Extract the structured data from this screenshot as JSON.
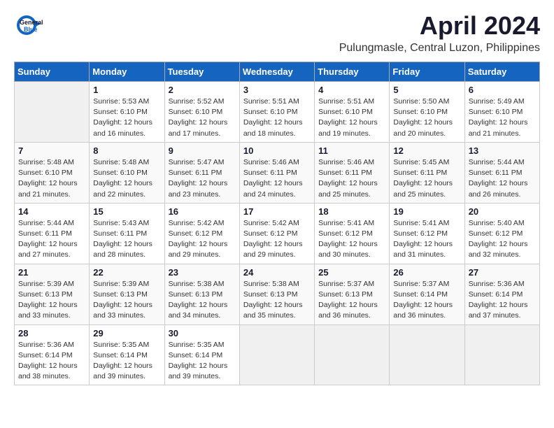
{
  "logo": {
    "line1": "General",
    "line2": "Blue"
  },
  "title": "April 2024",
  "subtitle": "Pulungmasle, Central Luzon, Philippines",
  "days_of_week": [
    "Sunday",
    "Monday",
    "Tuesday",
    "Wednesday",
    "Thursday",
    "Friday",
    "Saturday"
  ],
  "weeks": [
    [
      {
        "day": "",
        "info": ""
      },
      {
        "day": "1",
        "info": "Sunrise: 5:53 AM\nSunset: 6:10 PM\nDaylight: 12 hours\nand 16 minutes."
      },
      {
        "day": "2",
        "info": "Sunrise: 5:52 AM\nSunset: 6:10 PM\nDaylight: 12 hours\nand 17 minutes."
      },
      {
        "day": "3",
        "info": "Sunrise: 5:51 AM\nSunset: 6:10 PM\nDaylight: 12 hours\nand 18 minutes."
      },
      {
        "day": "4",
        "info": "Sunrise: 5:51 AM\nSunset: 6:10 PM\nDaylight: 12 hours\nand 19 minutes."
      },
      {
        "day": "5",
        "info": "Sunrise: 5:50 AM\nSunset: 6:10 PM\nDaylight: 12 hours\nand 20 minutes."
      },
      {
        "day": "6",
        "info": "Sunrise: 5:49 AM\nSunset: 6:10 PM\nDaylight: 12 hours\nand 21 minutes."
      }
    ],
    [
      {
        "day": "7",
        "info": "Sunrise: 5:48 AM\nSunset: 6:10 PM\nDaylight: 12 hours\nand 21 minutes."
      },
      {
        "day": "8",
        "info": "Sunrise: 5:48 AM\nSunset: 6:10 PM\nDaylight: 12 hours\nand 22 minutes."
      },
      {
        "day": "9",
        "info": "Sunrise: 5:47 AM\nSunset: 6:11 PM\nDaylight: 12 hours\nand 23 minutes."
      },
      {
        "day": "10",
        "info": "Sunrise: 5:46 AM\nSunset: 6:11 PM\nDaylight: 12 hours\nand 24 minutes."
      },
      {
        "day": "11",
        "info": "Sunrise: 5:46 AM\nSunset: 6:11 PM\nDaylight: 12 hours\nand 25 minutes."
      },
      {
        "day": "12",
        "info": "Sunrise: 5:45 AM\nSunset: 6:11 PM\nDaylight: 12 hours\nand 25 minutes."
      },
      {
        "day": "13",
        "info": "Sunrise: 5:44 AM\nSunset: 6:11 PM\nDaylight: 12 hours\nand 26 minutes."
      }
    ],
    [
      {
        "day": "14",
        "info": "Sunrise: 5:44 AM\nSunset: 6:11 PM\nDaylight: 12 hours\nand 27 minutes."
      },
      {
        "day": "15",
        "info": "Sunrise: 5:43 AM\nSunset: 6:11 PM\nDaylight: 12 hours\nand 28 minutes."
      },
      {
        "day": "16",
        "info": "Sunrise: 5:42 AM\nSunset: 6:12 PM\nDaylight: 12 hours\nand 29 minutes."
      },
      {
        "day": "17",
        "info": "Sunrise: 5:42 AM\nSunset: 6:12 PM\nDaylight: 12 hours\nand 29 minutes."
      },
      {
        "day": "18",
        "info": "Sunrise: 5:41 AM\nSunset: 6:12 PM\nDaylight: 12 hours\nand 30 minutes."
      },
      {
        "day": "19",
        "info": "Sunrise: 5:41 AM\nSunset: 6:12 PM\nDaylight: 12 hours\nand 31 minutes."
      },
      {
        "day": "20",
        "info": "Sunrise: 5:40 AM\nSunset: 6:12 PM\nDaylight: 12 hours\nand 32 minutes."
      }
    ],
    [
      {
        "day": "21",
        "info": "Sunrise: 5:39 AM\nSunset: 6:13 PM\nDaylight: 12 hours\nand 33 minutes."
      },
      {
        "day": "22",
        "info": "Sunrise: 5:39 AM\nSunset: 6:13 PM\nDaylight: 12 hours\nand 33 minutes."
      },
      {
        "day": "23",
        "info": "Sunrise: 5:38 AM\nSunset: 6:13 PM\nDaylight: 12 hours\nand 34 minutes."
      },
      {
        "day": "24",
        "info": "Sunrise: 5:38 AM\nSunset: 6:13 PM\nDaylight: 12 hours\nand 35 minutes."
      },
      {
        "day": "25",
        "info": "Sunrise: 5:37 AM\nSunset: 6:13 PM\nDaylight: 12 hours\nand 36 minutes."
      },
      {
        "day": "26",
        "info": "Sunrise: 5:37 AM\nSunset: 6:14 PM\nDaylight: 12 hours\nand 36 minutes."
      },
      {
        "day": "27",
        "info": "Sunrise: 5:36 AM\nSunset: 6:14 PM\nDaylight: 12 hours\nand 37 minutes."
      }
    ],
    [
      {
        "day": "28",
        "info": "Sunrise: 5:36 AM\nSunset: 6:14 PM\nDaylight: 12 hours\nand 38 minutes."
      },
      {
        "day": "29",
        "info": "Sunrise: 5:35 AM\nSunset: 6:14 PM\nDaylight: 12 hours\nand 39 minutes."
      },
      {
        "day": "30",
        "info": "Sunrise: 5:35 AM\nSunset: 6:14 PM\nDaylight: 12 hours\nand 39 minutes."
      },
      {
        "day": "",
        "info": ""
      },
      {
        "day": "",
        "info": ""
      },
      {
        "day": "",
        "info": ""
      },
      {
        "day": "",
        "info": ""
      }
    ]
  ]
}
